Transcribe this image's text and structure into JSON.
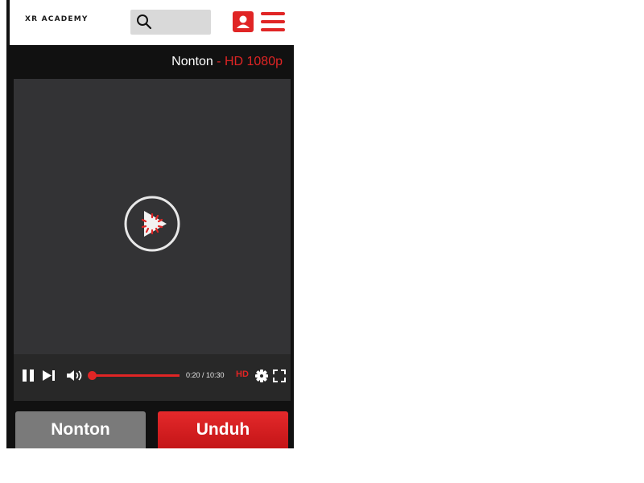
{
  "header": {
    "logo": "XR ACADEMY",
    "search": {
      "value": "",
      "placeholder": ""
    }
  },
  "titlebar": {
    "main": "Nonton",
    "quality": " - HD 1080p"
  },
  "player": {
    "time": "0:20 / 10:30",
    "hd_label": "HD",
    "progress_fraction": 0.03
  },
  "actions": {
    "watch_label": "Nonton",
    "download_label": "Unduh"
  },
  "colors": {
    "accent": "#e02525",
    "watch_button": "#7a7a7a",
    "video_bg": "#333335"
  },
  "icons": [
    "search-icon",
    "profile-icon",
    "menu-icon",
    "play-icon",
    "pause-icon",
    "next-icon",
    "volume-icon",
    "settings-icon",
    "fullscreen-icon"
  ]
}
